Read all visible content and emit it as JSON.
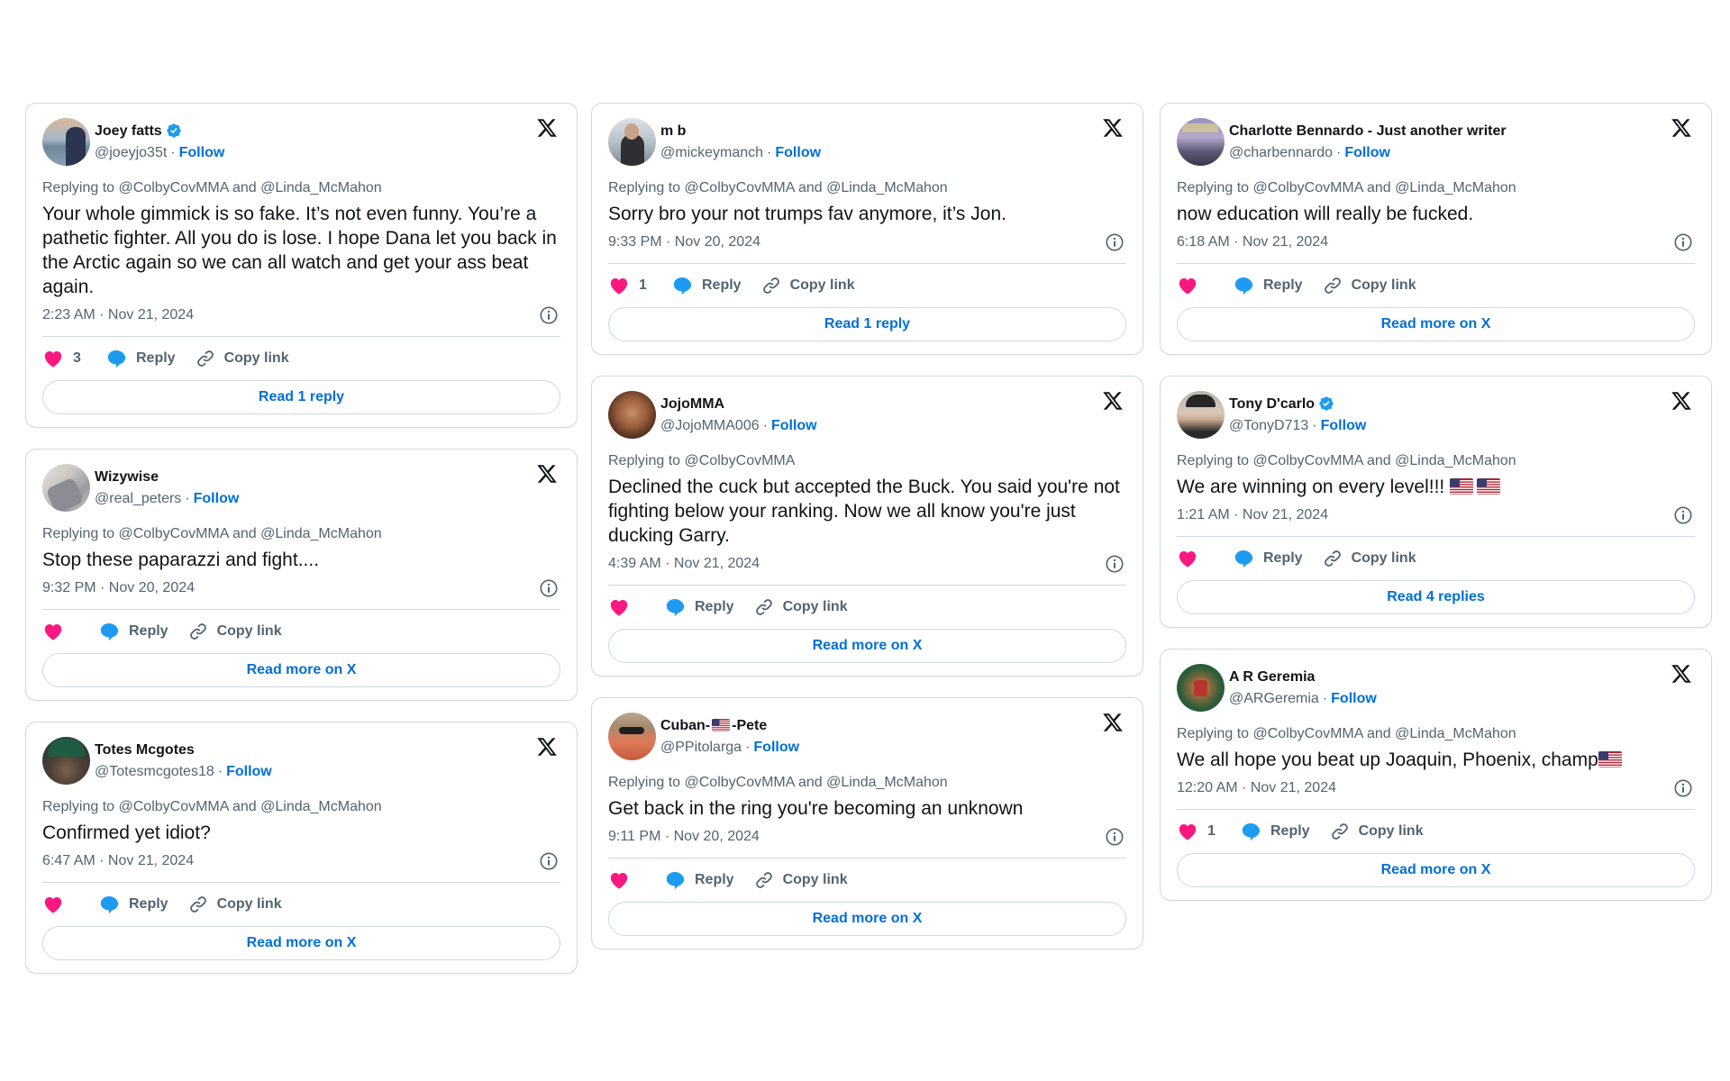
{
  "colors": {
    "like": "#f91880",
    "reply": "#1d9bf0",
    "follow": "#006fd6",
    "verified": "#1d9bf0",
    "muted": "#536471",
    "text": "#0f1419",
    "border": "#cfd9de"
  },
  "labels": {
    "follow": "Follow",
    "reply": "Reply",
    "copy_link": "Copy link",
    "separator": "·"
  },
  "tweets": [
    {
      "name": "Joey fatts",
      "verified": true,
      "handle": "@joeyjo35t",
      "replying_to": "Replying to @ColbyCovMMA and @Linda_McMahon",
      "text": "Your whole gimmick is so fake. It’s not even funny. You’re a pathetic fighter. All you do is lose. I hope Dana let you back in the Arctic again so we can all watch and get your ass beat again.",
      "timestamp": "2:23 AM · Nov 21, 2024",
      "likes": "3",
      "cta": "Read 1 reply"
    },
    {
      "name": "Wizywise",
      "verified": false,
      "handle": "@real_peters",
      "replying_to": "Replying to @ColbyCovMMA and @Linda_McMahon",
      "text": "Stop these paparazzi and fight....",
      "timestamp": "9:32 PM · Nov 20, 2024",
      "likes": "",
      "cta": "Read more on X"
    },
    {
      "name": "Totes Mcgotes",
      "verified": false,
      "handle": "@Totesmcgotes18",
      "replying_to": "Replying to @ColbyCovMMA and @Linda_McMahon",
      "text": "Confirmed yet idiot?",
      "timestamp": "6:47 AM · Nov 21, 2024",
      "likes": "",
      "cta": "Read more on X"
    },
    {
      "name": "m b",
      "verified": false,
      "handle": "@mickeymanch",
      "replying_to": "Replying to @ColbyCovMMA and @Linda_McMahon",
      "text": "Sorry bro your not trumps fav anymore, it’s Jon.",
      "timestamp": "9:33 PM · Nov 20, 2024",
      "likes": "1",
      "cta": "Read 1 reply"
    },
    {
      "name": "JojoMMA",
      "verified": false,
      "handle": "@JojoMMA006",
      "replying_to": "Replying to @ColbyCovMMA",
      "text": "Declined the cuck but accepted the Buck. You said you're not fighting below your ranking. Now we all know you're just ducking Garry.",
      "timestamp": "4:39 AM · Nov 21, 2024",
      "likes": "",
      "cta": "Read more on X"
    },
    {
      "name_prefix": "Cuban-",
      "name_suffix": "-Pete",
      "name_flag": "us-flag-emoji",
      "verified": false,
      "handle": "@PPitolarga",
      "replying_to": "Replying to @ColbyCovMMA and @Linda_McMahon",
      "text": "Get back in the ring you're becoming an unknown",
      "timestamp": "9:11 PM · Nov 20, 2024",
      "likes": "",
      "cta": "Read more on X"
    },
    {
      "name": "Charlotte Bennardo - Just another writer",
      "verified": false,
      "handle": "@charbennardo",
      "replying_to": "Replying to @ColbyCovMMA and @Linda_McMahon",
      "text": "now education will really be fucked.",
      "timestamp": "6:18 AM · Nov 21, 2024",
      "likes": "",
      "cta": "Read more on X"
    },
    {
      "name": "Tony D'carlo",
      "verified": true,
      "handle": "@TonyD713",
      "replying_to": "Replying to @ColbyCovMMA and @Linda_McMahon",
      "text": "We are winning on every level!!! ",
      "text_emoji": [
        "us-flag-emoji",
        "us-flag-emoji"
      ],
      "timestamp": "1:21 AM · Nov 21, 2024",
      "likes": "",
      "cta": "Read 4 replies"
    },
    {
      "name": "A R Geremia",
      "verified": false,
      "handle": "@ARGeremia",
      "replying_to": "Replying to @ColbyCovMMA and @Linda_McMahon",
      "text": "We all hope you beat up Joaquin, Phoenix, champ",
      "text_emoji": [
        "us-flag-emoji"
      ],
      "timestamp": "12:20 AM · Nov 21, 2024",
      "likes": "1",
      "cta": "Read more on X"
    }
  ]
}
